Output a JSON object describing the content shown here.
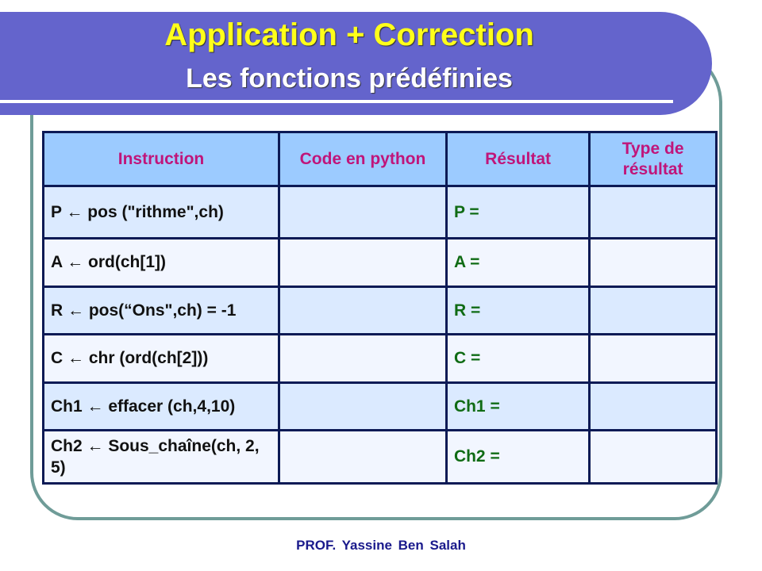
{
  "header": {
    "title": "Application + Correction",
    "subtitle": "Les fonctions prédéfinies"
  },
  "colors": {
    "banner": "#6464cc",
    "title": "#ffff1a",
    "frame": "#6f9c98",
    "header_text": "#c0157a",
    "result_text": "#0f6b14",
    "footer_text": "#1a1a8c"
  },
  "table": {
    "columns": [
      "Instruction",
      "Code en python",
      "Résultat",
      "Type de résultat"
    ],
    "rows": [
      {
        "instruction": "P ← pos (\"rithme\",ch)",
        "code": "",
        "result": "P =",
        "type": ""
      },
      {
        "instruction": "A ← ord(ch[1])",
        "code": "",
        "result": "A =",
        "type": ""
      },
      {
        "instruction": "R ← pos(“Ons\",ch) = -1",
        "code": "",
        "result": "R =",
        "type": ""
      },
      {
        "instruction": "C ← chr (ord(ch[2]))",
        "code": "",
        "result": "C =",
        "type": ""
      },
      {
        "instruction": "Ch1 ← effacer (ch,4,10)",
        "code": "",
        "result": "Ch1 =",
        "type": ""
      },
      {
        "instruction": "Ch2 ← Sous_chaîne(ch, 2, 5)",
        "code": "",
        "result": "Ch2 =",
        "type": ""
      }
    ]
  },
  "footer": {
    "author": "PROF. Yassine Ben Salah"
  }
}
